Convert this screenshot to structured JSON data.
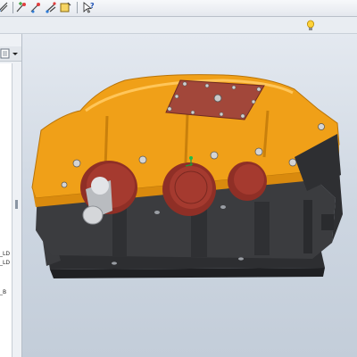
{
  "toolbar": {
    "icons": [
      "snap-grid-icon",
      "node-add-icon",
      "node-edit-icon",
      "node-refine-icon",
      "query-icon",
      "help-whats-this-icon"
    ]
  },
  "strip": {
    "icons": [
      "lightbulb-icon"
    ]
  },
  "tree": {
    "node_labels": [
      "_LD",
      "_LD",
      "_B"
    ]
  },
  "viewport": {
    "model": "helical-gear-reducer-3d-model",
    "colors": {
      "housing_top": "#f0a018",
      "housing_bottom": "#3b3c3f",
      "bearing_caps": "#a53a2f",
      "shaft": "#d5d7da",
      "background_top": "#e4e9f0",
      "background_bottom": "#c3cdd9"
    }
  }
}
